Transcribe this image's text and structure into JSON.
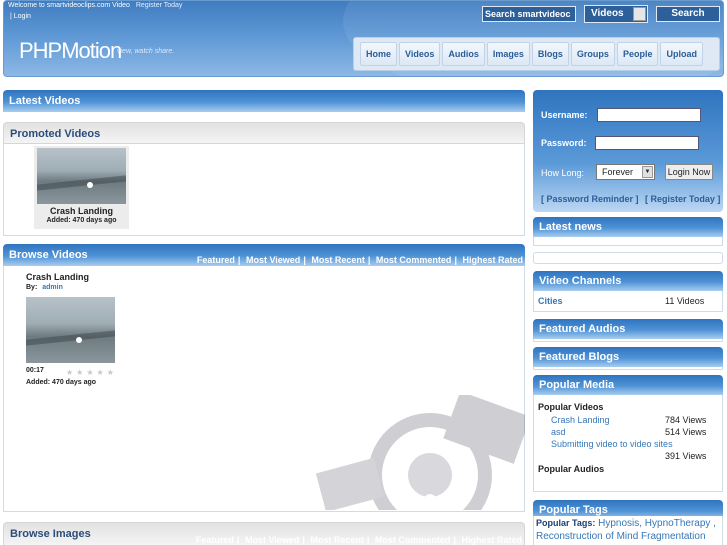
{
  "header": {
    "welcome": "Welcome  to smartvideoclips.com Video",
    "register": "Register Today",
    "login": "| Login",
    "logo": "PHPMotion",
    "tagline": "view, watch share.",
    "search_placeholder": "Search smartvideoc",
    "search_type": "Videos",
    "search_button": "Search",
    "nav": [
      "Home",
      "Videos",
      "Audios",
      "Images",
      "Blogs",
      "Groups",
      "People",
      "Upload"
    ]
  },
  "main": {
    "latest_videos_title": "Latest Videos",
    "promoted_title": "Promoted Videos",
    "promoted": {
      "title": "Crash Landing",
      "added": "Added: 470 days ago"
    },
    "browse_videos_title": "Browse Videos",
    "sort_links": [
      "Featured",
      "Most Viewed",
      "Most Recent",
      "Most Commented",
      "Highest Rated"
    ],
    "browse_item": {
      "title": "Crash Landing",
      "by_label": "By:",
      "author": "admin",
      "duration": "00:17",
      "added": "Added: 470 days ago",
      "rating_stars": 0
    },
    "browse_images_title": "Browse Images"
  },
  "sidebar": {
    "username_label": "Username:",
    "password_label": "Password:",
    "how_long_label": "How Long:",
    "how_long_value": "Forever",
    "login_button": "Login Now",
    "password_reminder": "[ Password Reminder ]",
    "register_today": "[ Register Today ]",
    "latest_news_title": "Latest news",
    "video_channels_title": "Video Channels",
    "channel": {
      "name": "Cities",
      "count": "11 Videos"
    },
    "featured_audios_title": "Featured Audios",
    "featured_blogs_title": "Featured Blogs",
    "popular_media_title": "Popular Media",
    "popular_videos_label": "Popular Videos",
    "popular_videos": [
      {
        "title": "Crash Landing",
        "views": "784 Views"
      },
      {
        "title": "asd",
        "views": "514 Views"
      },
      {
        "title": "Submitting video to video sites",
        "views": "391 Views"
      }
    ],
    "popular_audios_label": "Popular Audios",
    "popular_tags_title": "Popular Tags",
    "popular_tags_label": "Popular Tags:",
    "tags": "Hypnosis, HypnoTherapy , Reconstruction of Mind Fragmentation"
  }
}
